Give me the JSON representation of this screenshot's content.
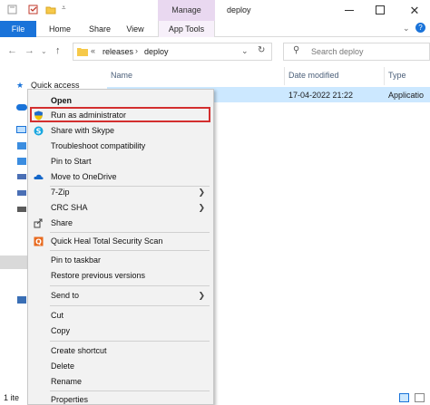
{
  "titlebar": {
    "manage_label": "Manage",
    "window_title": "deploy"
  },
  "ribbon": {
    "tabs": [
      "File",
      "Home",
      "Share",
      "View",
      "App Tools"
    ]
  },
  "address": {
    "breadcrumb_prefix": "«",
    "path": [
      "releases",
      "deploy"
    ],
    "search_placeholder": "Search deploy"
  },
  "columns": {
    "name": "Name",
    "date_modified": "Date modified",
    "type": "Type"
  },
  "nav": {
    "quick_access": "Quick access"
  },
  "file": {
    "date": "17-04-2022 21:22",
    "type": "Applicatio"
  },
  "menu": {
    "items": [
      {
        "label": "Open",
        "bold": true
      },
      {
        "label": "Run as administrator"
      },
      {
        "label": "Share with Skype"
      },
      {
        "label": "Troubleshoot compatibility"
      },
      {
        "label": "Pin to Start"
      },
      {
        "label": "Move to OneDrive"
      },
      {
        "label": "7-Zip",
        "submenu": true
      },
      {
        "label": "CRC SHA",
        "submenu": true
      },
      {
        "label": "Share"
      },
      {
        "label": "Quick Heal Total Security Scan"
      },
      {
        "label": "Pin to taskbar"
      },
      {
        "label": "Restore previous versions"
      },
      {
        "label": "Send to",
        "submenu": true
      },
      {
        "label": "Cut"
      },
      {
        "label": "Copy"
      },
      {
        "label": "Create shortcut"
      },
      {
        "label": "Delete"
      },
      {
        "label": "Rename"
      },
      {
        "label": "Properties"
      }
    ]
  },
  "status": {
    "items_text": "1 ite"
  },
  "colors": {
    "accent": "#1a73d9",
    "selection": "#cce8ff",
    "manage": "#e9d8f0",
    "highlight_border": "#d32f2f"
  }
}
